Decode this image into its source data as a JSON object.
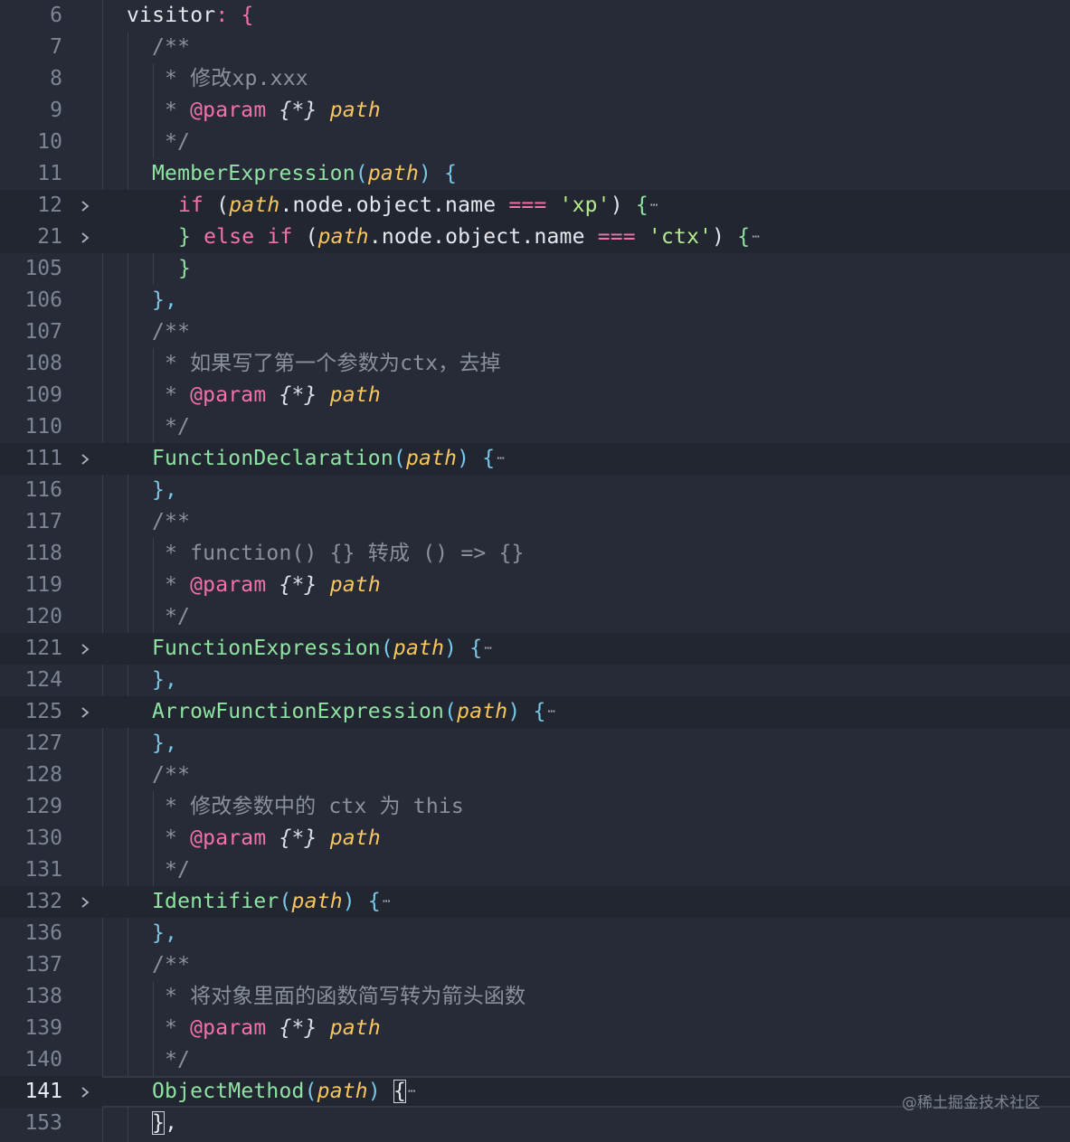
{
  "lines": [
    {
      "n": "6"
    },
    {
      "n": "7"
    },
    {
      "n": "8"
    },
    {
      "n": "9"
    },
    {
      "n": "10"
    },
    {
      "n": "11"
    },
    {
      "n": "12"
    },
    {
      "n": "21"
    },
    {
      "n": "105"
    },
    {
      "n": "106"
    },
    {
      "n": "107"
    },
    {
      "n": "108"
    },
    {
      "n": "109"
    },
    {
      "n": "110"
    },
    {
      "n": "111"
    },
    {
      "n": "116"
    },
    {
      "n": "117"
    },
    {
      "n": "118"
    },
    {
      "n": "119"
    },
    {
      "n": "120"
    },
    {
      "n": "121"
    },
    {
      "n": "124"
    },
    {
      "n": "125"
    },
    {
      "n": "127"
    },
    {
      "n": "128"
    },
    {
      "n": "129"
    },
    {
      "n": "130"
    },
    {
      "n": "131"
    },
    {
      "n": "132"
    },
    {
      "n": "136"
    },
    {
      "n": "137"
    },
    {
      "n": "138"
    },
    {
      "n": "139"
    },
    {
      "n": "140"
    },
    {
      "n": "141"
    },
    {
      "n": "153"
    }
  ],
  "tokens": {
    "visitor": "visitor",
    "colon_brace": ": {",
    "doc_open": "/**",
    "doc_close": "*/",
    "star": "* ",
    "param_tag": "@param",
    "param_type": "{*}",
    "path": "path",
    "c1_text": "修改xp.xxx",
    "member_expression": "MemberExpression",
    "if_kw": "if",
    "else_kw": "else",
    "node_object_name": ".node.object.name",
    "strict_eq": "===",
    "str_xp": "'xp'",
    "str_ctx": "'ctx'",
    "c2_text": "如果写了第一个参数为ctx，去掉",
    "function_declaration": "FunctionDeclaration",
    "c3_text": "function() {} 转成 () => {}",
    "function_expression": "FunctionExpression",
    "arrow_function_expression": "ArrowFunctionExpression",
    "c4_text": "修改参数中的 ctx 为 this",
    "identifier": "Identifier",
    "c5_text": "将对象里面的函数简写转为箭头函数",
    "object_method": "ObjectMethod",
    "open_brace": "{",
    "close_brace": "}",
    "closing": "},",
    "ellipsis": "⋯"
  },
  "watermark": "@稀土掘金技术社区"
}
